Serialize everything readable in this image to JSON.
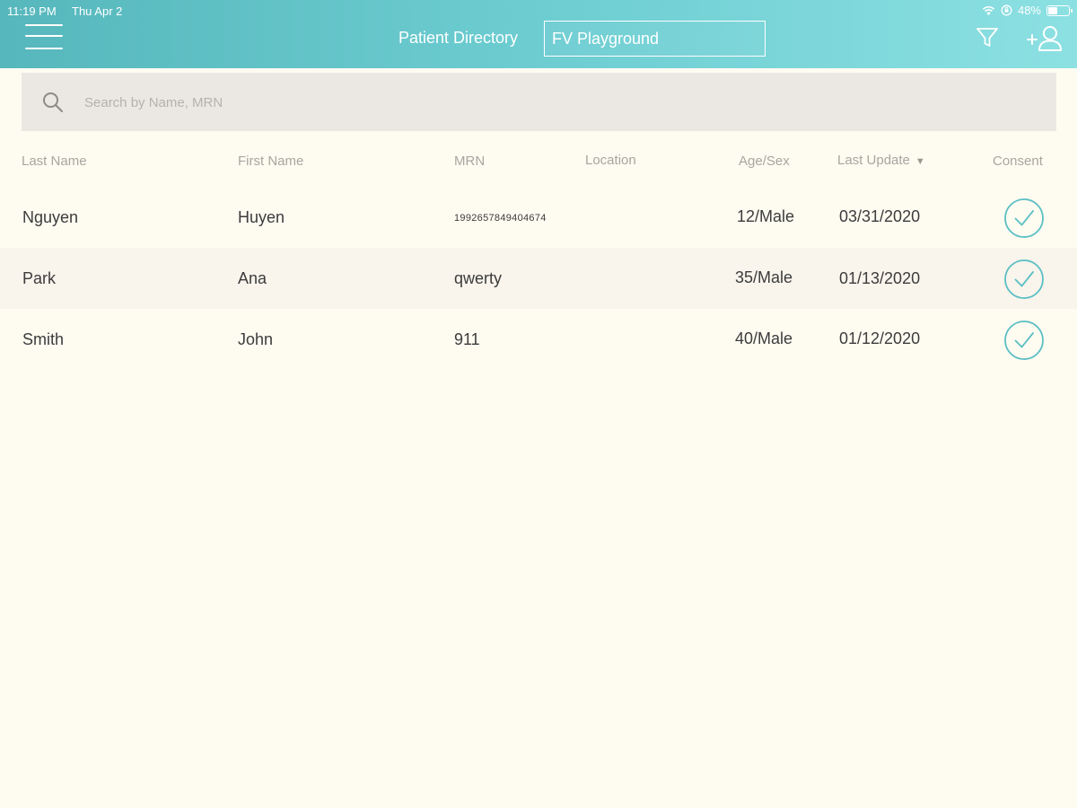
{
  "status_bar": {
    "time": "11:19 PM",
    "date": "Thu Apr 2",
    "battery": "48%",
    "icons": [
      "wifi-icon",
      "lock-rotation-icon",
      "battery-icon"
    ]
  },
  "header": {
    "title": "Patient Directory",
    "facility": "FV Playground",
    "icons": [
      "menu-icon",
      "filter-icon",
      "add-patient-icon"
    ]
  },
  "search": {
    "placeholder": "Search by Name, MRN",
    "value": "",
    "icon": "search-icon"
  },
  "table": {
    "columns": {
      "last_name": "Last Name",
      "first_name": "First Name",
      "mrn": "MRN",
      "location": "Location",
      "age_sex": "Age/Sex",
      "last_update": "Last Update",
      "consent": "Consent"
    },
    "sort": {
      "column": "Last Update",
      "direction": "descending"
    },
    "rows": [
      {
        "last_name": "Nguyen",
        "first_name": "Huyen",
        "mrn": "1992657849404674",
        "location": "",
        "age_sex": "12/Male",
        "last_update": "03/31/2020",
        "consent": true
      },
      {
        "last_name": "Park",
        "first_name": "Ana",
        "mrn": "qwerty",
        "location": "",
        "age_sex": "35/Male",
        "last_update": "01/13/2020",
        "consent": true
      },
      {
        "last_name": "Smith",
        "first_name": "John",
        "mrn": "911",
        "location": "",
        "age_sex": "40/Male",
        "last_update": "01/12/2020",
        "consent": true
      }
    ]
  },
  "colors": {
    "header_start": "#56b7bc",
    "header_end": "#8ce0e2",
    "accent": "#5bbfc4",
    "background": "#fefbf1",
    "row_alt": "#f9f4ec",
    "search_bg": "#ebe8e3"
  }
}
